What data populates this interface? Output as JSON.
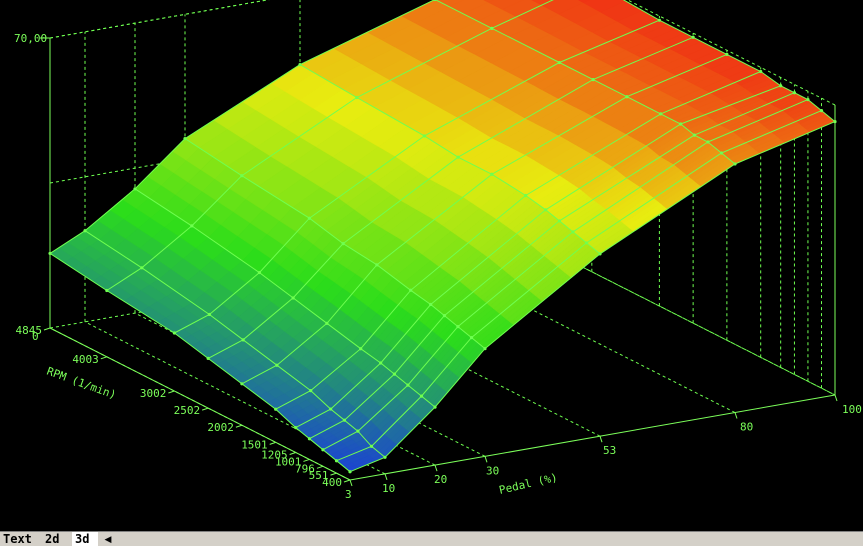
{
  "tabs": [
    {
      "label": "Text"
    },
    {
      "label": "2d"
    },
    {
      "label": "3d"
    }
  ],
  "scroll_left_icon": "◀",
  "colors": {
    "background": "#000000",
    "axis": "#7cff5a",
    "grid": "#6fff50",
    "mesh": "#6fff50",
    "low": "#1a38e0",
    "mid": "#2bdd1a",
    "midhigh": "#e8ec10",
    "high": "#f02a14"
  },
  "chart_data": {
    "type": "surface",
    "title": "",
    "zmax_label": "70,00",
    "zmin_label": "0",
    "zlim": [
      0,
      70
    ],
    "xlabel": "Pedal (%)",
    "ylabel": "RPM (1/min)",
    "x_ticks": [
      "3",
      "10",
      "20",
      "30",
      "53",
      "80",
      "100"
    ],
    "y_ticks": [
      "400",
      "600",
      "801",
      "1001",
      "1205",
      "1501",
      "2002",
      "2502",
      "3002",
      "4003",
      "4845"
    ],
    "y_tick_labels_visible": [
      "400",
      "551",
      "796",
      "1001",
      "1205",
      "1501",
      "2002",
      "2502",
      "3002",
      "4003",
      "4845"
    ],
    "pedal": [
      3,
      10,
      20,
      30,
      53,
      80,
      100
    ],
    "rpm": [
      400,
      600,
      801,
      1001,
      1205,
      1501,
      2002,
      2502,
      3002,
      4003,
      4845
    ],
    "z": [
      [
        2,
        3,
        4,
        5,
        6,
        8,
        10,
        12,
        14,
        16,
        18
      ],
      [
        4,
        5,
        7,
        8,
        9,
        11,
        13,
        15,
        17,
        20,
        22
      ],
      [
        14,
        15,
        16,
        17,
        18,
        19,
        21,
        23,
        25,
        28,
        30
      ],
      [
        26,
        27,
        28,
        29,
        30,
        31,
        33,
        34,
        36,
        38,
        40
      ],
      [
        44,
        45,
        46,
        47,
        48,
        49,
        50,
        50,
        51,
        52,
        53
      ],
      [
        60,
        61,
        62,
        62,
        63,
        63,
        63,
        63,
        63,
        63,
        63
      ],
      [
        66,
        67,
        68,
        68,
        68,
        69,
        69,
        69,
        69,
        70,
        70
      ]
    ]
  }
}
